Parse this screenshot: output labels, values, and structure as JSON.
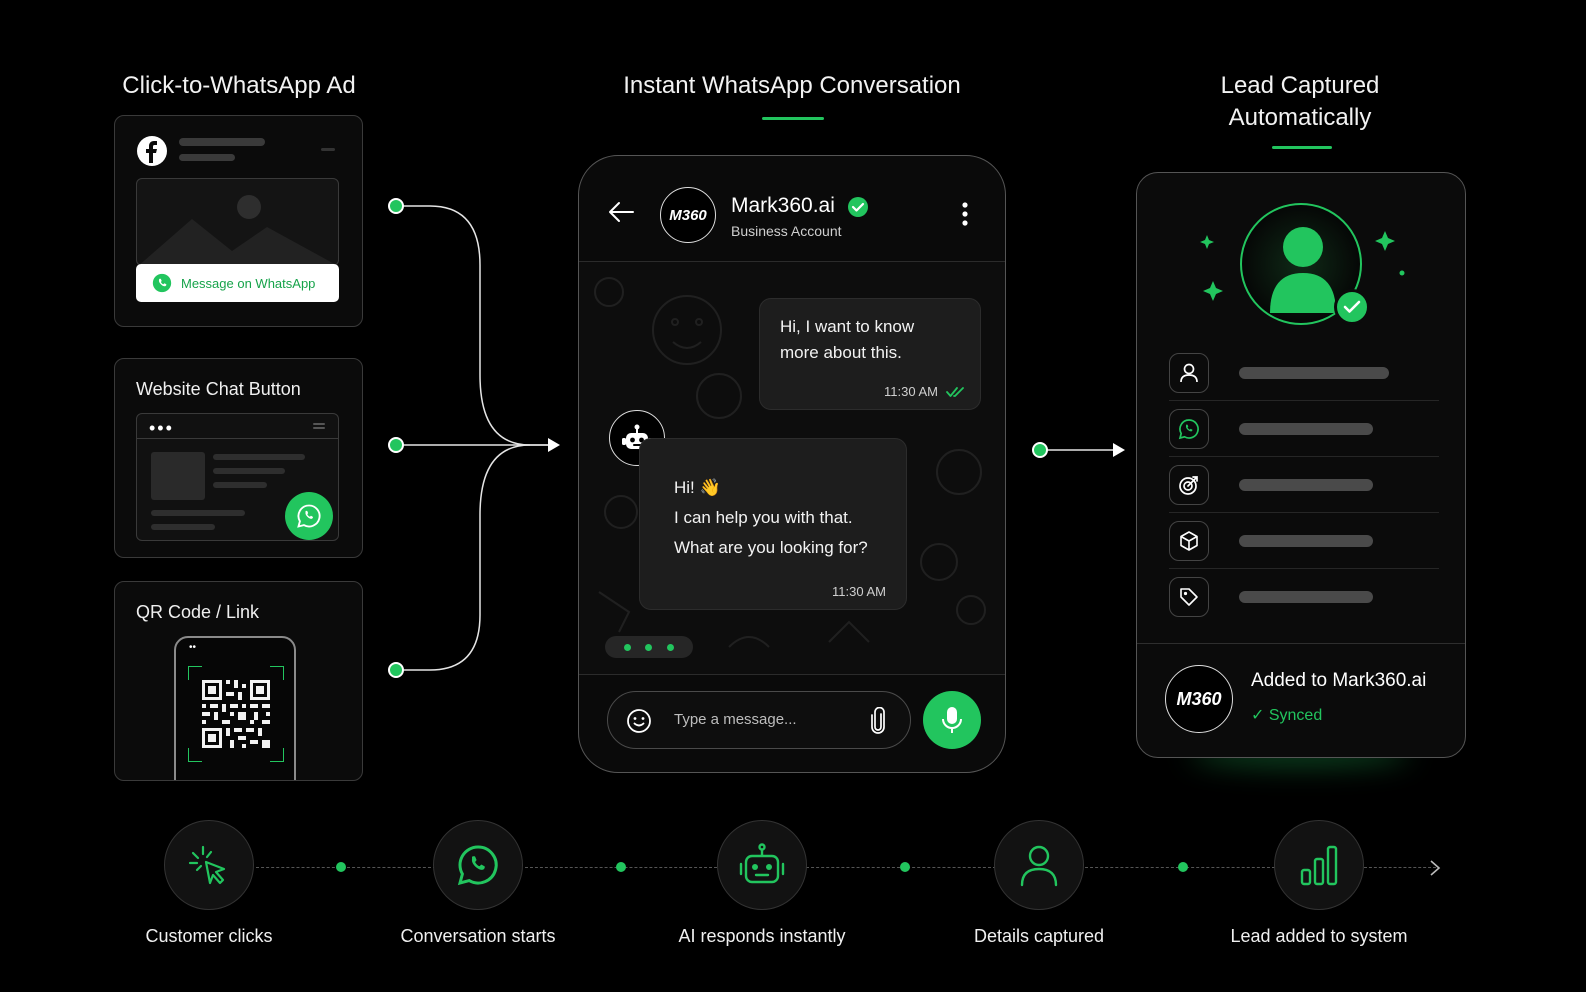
{
  "colors": {
    "accent": "#22c55e",
    "background": "#000000",
    "card": "#0b0b0b"
  },
  "columns": {
    "left_title": "Click-to-WhatsApp Ad",
    "center_title": "Instant WhatsApp Conversation",
    "right_title_line1": "Lead Captured",
    "right_title_line2": "Automatically"
  },
  "sources": {
    "ad_button": "Message on WhatsApp",
    "website_label": "Website Chat Button",
    "qr_label": "QR Code / Link"
  },
  "chat": {
    "name": "Mark360.ai",
    "account_type": "Business Account",
    "avatar_text": "M360",
    "user_msg_line1": "Hi, I want to know",
    "user_msg_line2": "more about this.",
    "user_time": "11:30 AM",
    "bot_line1": "Hi! 👋",
    "bot_line2": "I can help you with that.",
    "bot_line3": "What are you looking for?",
    "bot_time": "11:30 AM",
    "input_placeholder": "Type a message..."
  },
  "lead": {
    "added_text": "Added to Mark360.ai",
    "synced_text": "✓ Synced",
    "avatar_text": "M360",
    "field_icons": [
      "user-icon",
      "whatsapp-icon",
      "target-icon",
      "cube-icon",
      "tag-icon"
    ]
  },
  "steps": [
    {
      "label": "Customer clicks",
      "icon": "click-cursor-icon"
    },
    {
      "label": "Conversation starts",
      "icon": "whatsapp-icon"
    },
    {
      "label": "AI responds instantly",
      "icon": "robot-icon"
    },
    {
      "label": "Details captured",
      "icon": "user-icon"
    },
    {
      "label": "Lead added to system",
      "icon": "bar-chart-icon"
    }
  ]
}
